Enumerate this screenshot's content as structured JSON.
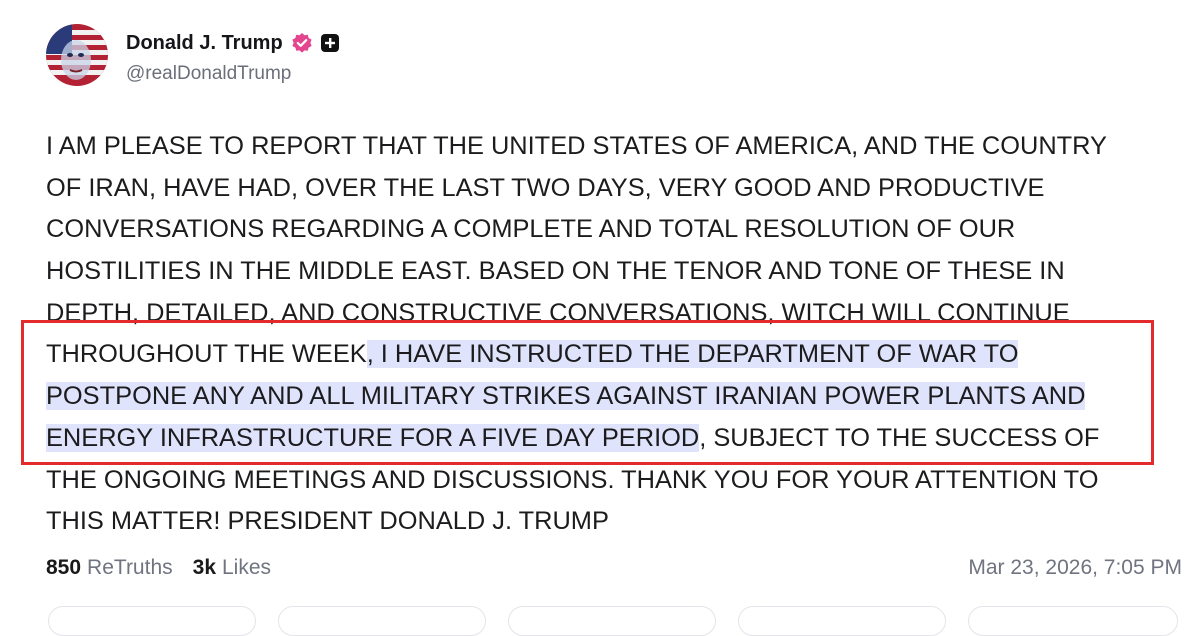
{
  "author": {
    "display_name": "Donald J. Trump",
    "handle": "@realDonaldTrump",
    "verified_icon": "verified-badge-icon",
    "extra_icon": "plus-badge-icon"
  },
  "post": {
    "lines": [
      {
        "pre": "I AM PLEASE TO REPORT THAT THE UNITED STATES OF AMERICA, AND THE COUNTRY",
        "hl": "",
        "post": ""
      },
      {
        "pre": "OF IRAN, HAVE HAD, OVER THE LAST TWO DAYS, VERY GOOD AND PRODUCTIVE",
        "hl": "",
        "post": ""
      },
      {
        "pre": "CONVERSATIONS REGARDING A COMPLETE AND TOTAL RESOLUTION OF OUR",
        "hl": "",
        "post": ""
      },
      {
        "pre": "HOSTILITIES IN THE MIDDLE EAST. BASED ON THE TENOR AND TONE OF THESE IN",
        "hl": "",
        "post": ""
      },
      {
        "pre": "DEPTH, DETAILED, AND CONSTRUCTIVE CONVERSATIONS, WITCH WILL CONTINUE",
        "hl": "",
        "post": ""
      },
      {
        "pre": "THROUGHOUT THE WEEK",
        "hl": ", I HAVE INSTRUCTED THE DEPARTMENT OF WAR TO ",
        "post": ""
      },
      {
        "pre": "",
        "hl": "POSTPONE ANY AND ALL MILITARY STRIKES AGAINST IRANIAN POWER PLANTS AND ",
        "post": ""
      },
      {
        "pre": "",
        "hl": "ENERGY INFRASTRUCTURE FOR A FIVE DAY PERIOD",
        "post": ", SUBJECT TO THE SUCCESS OF"
      },
      {
        "pre": "THE ONGOING MEETINGS AND DISCUSSIONS. THANK YOU FOR YOUR ATTENTION TO",
        "hl": "",
        "post": ""
      },
      {
        "pre": "THIS MATTER! PRESIDENT DONALD J. TRUMP",
        "hl": "",
        "post": ""
      }
    ]
  },
  "stats": {
    "retruths_count": "850",
    "retruths_label": "ReTruths",
    "likes_count": "3k",
    "likes_label": "Likes"
  },
  "timestamp": "Mar 23, 2026, 7:05 PM",
  "colors": {
    "highlight": "#dfe3fb",
    "annotation_box": "#e32b2b",
    "verified": "#e3458f"
  }
}
